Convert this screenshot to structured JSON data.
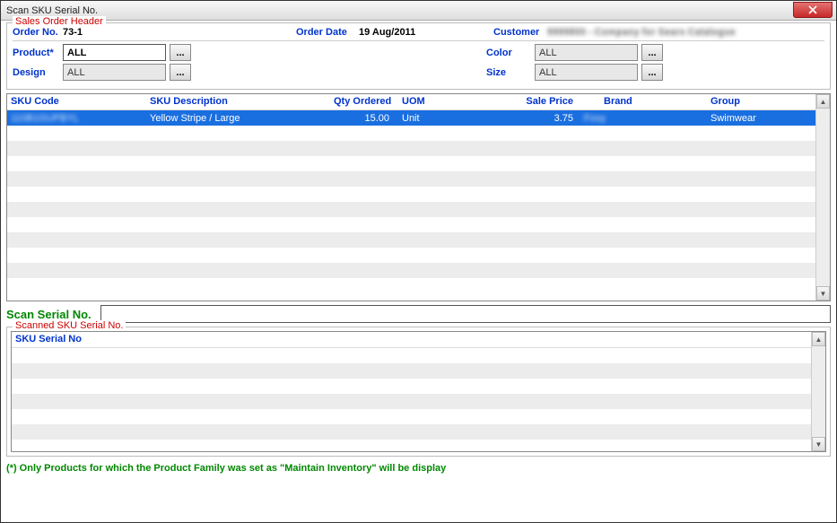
{
  "window": {
    "title": "Scan SKU Serial No."
  },
  "header": {
    "legend": "Sales Order Header",
    "order_no_label": "Order No.",
    "order_no_value": "73-1",
    "order_date_label": "Order Date",
    "order_date_value": "19 Aug/2011",
    "customer_label": "Customer",
    "customer_value": "9999800 - Company for Sears Catalogue",
    "product_label": "Product*",
    "product_value": "ALL",
    "color_label": "Color",
    "color_value": "ALL",
    "design_label": "Design",
    "design_value": "ALL",
    "size_label": "Size",
    "size_value": "ALL",
    "ellipsis": "..."
  },
  "grid": {
    "columns": {
      "sku_code": "SKU Code",
      "sku_desc": "SKU Description",
      "qty": "Qty Ordered",
      "uom": "UOM",
      "sale_price": "Sale Price",
      "brand": "Brand",
      "group": "Group"
    },
    "rows": [
      {
        "sku_code": "110B1GUPBYL",
        "sku_desc": "Yellow Stripe / Large",
        "qty": "15.00",
        "uom": "Unit",
        "sale_price": "3.75",
        "brand": "Foxy",
        "group": "Swimwear"
      }
    ],
    "scroll_up": "▲",
    "scroll_down": "▼"
  },
  "scan": {
    "label": "Scan Serial No.",
    "value": ""
  },
  "scanned": {
    "legend": "Scanned SKU Serial No.",
    "columns": {
      "serial": "SKU Serial No"
    }
  },
  "footnote": "(*) Only Products for which the Product Family was set as \"Maintain Inventory\" will be display"
}
